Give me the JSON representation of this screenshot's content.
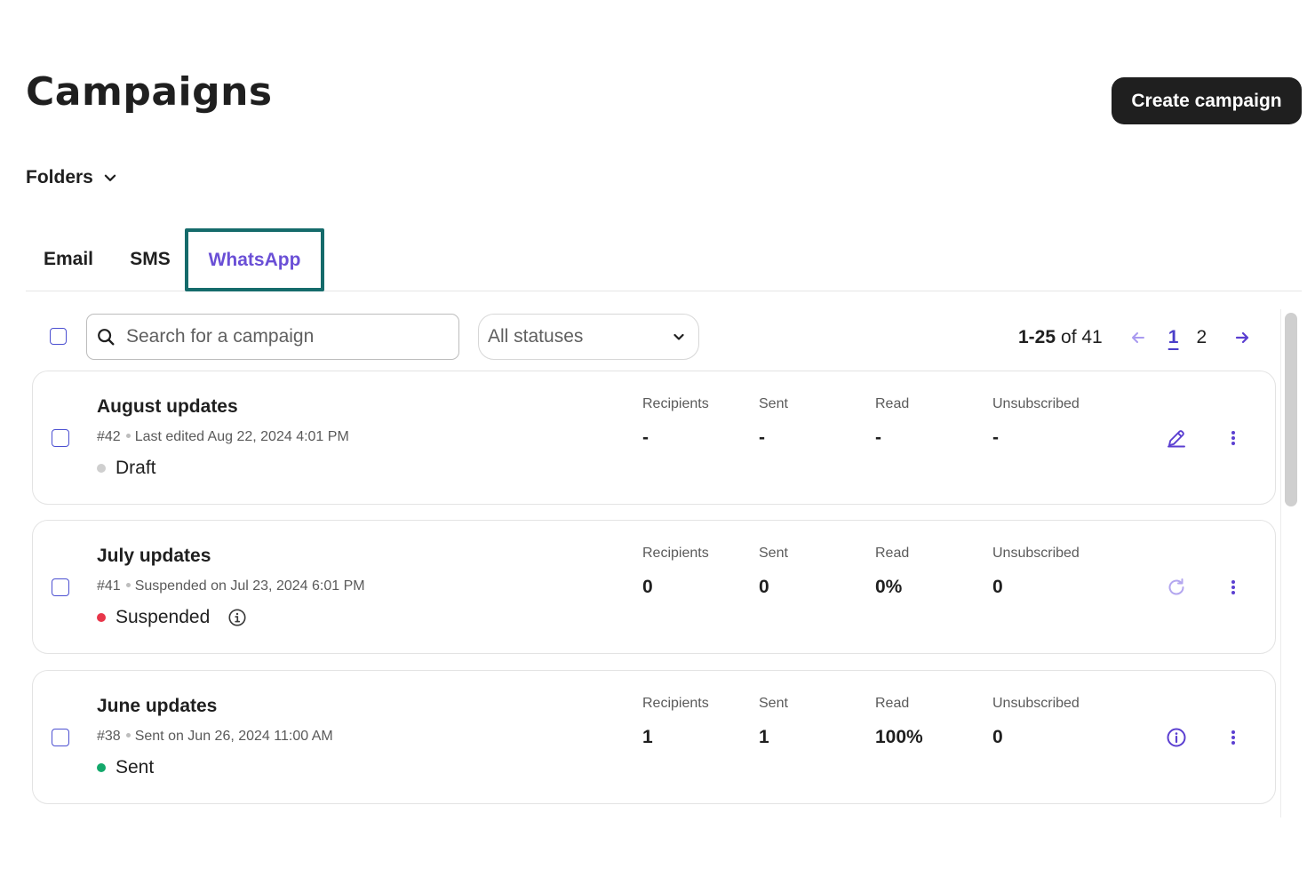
{
  "header": {
    "title": "Campaigns",
    "create_button": "Create campaign"
  },
  "folders": {
    "label": "Folders"
  },
  "tabs": [
    {
      "label": "Email",
      "active": false
    },
    {
      "label": "SMS",
      "active": false
    },
    {
      "label": "WhatsApp",
      "active": true
    }
  ],
  "toolbar": {
    "search_placeholder": "Search for a campaign",
    "status_filter": "All statuses",
    "pagination": {
      "range": "1-25",
      "of_text": "of 41",
      "pages": [
        "1",
        "2"
      ],
      "current_page": "1"
    }
  },
  "stat_labels": {
    "recipients": "Recipients",
    "sent": "Sent",
    "read": "Read",
    "unsubscribed": "Unsubscribed"
  },
  "campaigns": [
    {
      "name": "August updates",
      "id": "#42",
      "detail": "Last edited Aug 22, 2024 4:01 PM",
      "status": "Draft",
      "status_color": "#cfcfcf",
      "recipients": "-",
      "sent": "-",
      "read": "-",
      "unsubscribed": "-",
      "action_icon": "pencil-icon"
    },
    {
      "name": "July updates",
      "id": "#41",
      "detail": "Suspended on Jul 23, 2024 6:01 PM",
      "status": "Suspended",
      "status_color": "#e8364a",
      "recipients": "0",
      "sent": "0",
      "read": "0%",
      "unsubscribed": "0",
      "action_icon": "refresh-icon"
    },
    {
      "name": "June updates",
      "id": "#38",
      "detail": "Sent on Jun 26, 2024 11:00 AM",
      "status": "Sent",
      "status_color": "#13a86b",
      "recipients": "1",
      "sent": "1",
      "read": "100%",
      "unsubscribed": "0",
      "action_icon": "info-icon"
    }
  ],
  "colors": {
    "accent": "#6a4fd6",
    "primary_button": "#1f1f1f",
    "tab_focus_outline": "#156b6b"
  }
}
